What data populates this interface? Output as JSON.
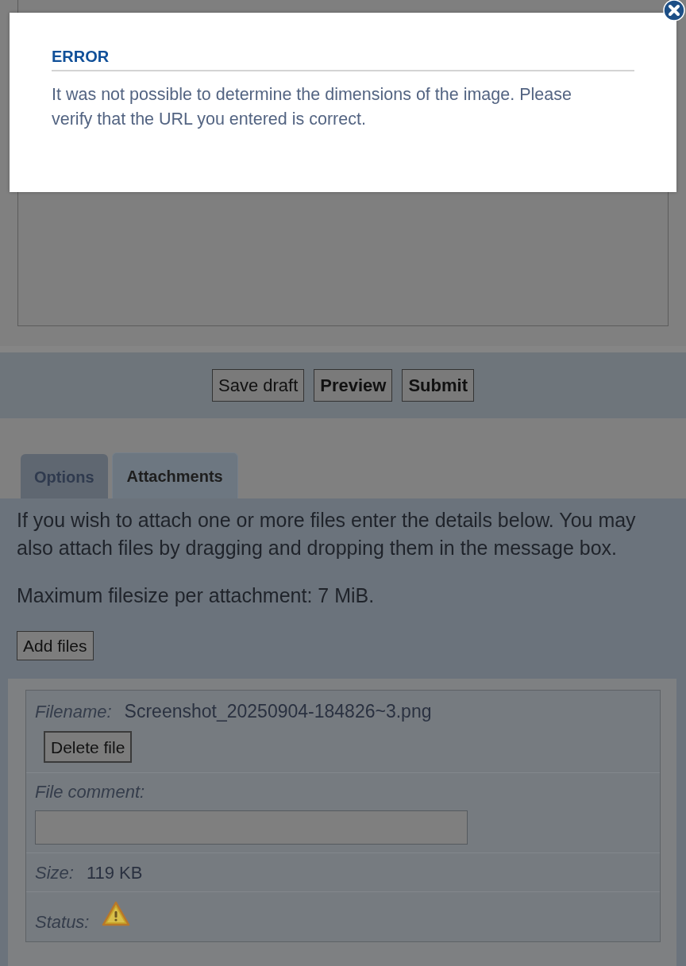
{
  "dialog": {
    "title": "ERROR",
    "message": "It was not possible to determine the dimensions of the image. Please verify that the URL you entered is correct."
  },
  "form_buttons": [
    {
      "label": "Save draft",
      "kind": "secondary"
    },
    {
      "label": "Preview",
      "kind": "primary"
    },
    {
      "label": "Submit",
      "kind": "primary"
    }
  ],
  "tabs": [
    {
      "label": "Options",
      "selected": false
    },
    {
      "label": "Attachments",
      "selected": true
    }
  ],
  "attachments_panel": {
    "intro": "If you wish to attach one or more files enter the details below. You may also attach files by dragging and dropping them in the message box.",
    "limit": "Maximum filesize per attachment: 7 MiB.",
    "add_button": "Add files"
  },
  "attachment": {
    "filename_label": "Filename:",
    "filename": "Screenshot_20250904-184826~3.png",
    "delete_button": "Delete file",
    "comment_label": "File comment:",
    "size_label": "Size:",
    "size": "119 KB",
    "status_label": "Status:",
    "status": {
      "warning": true
    }
  }
}
